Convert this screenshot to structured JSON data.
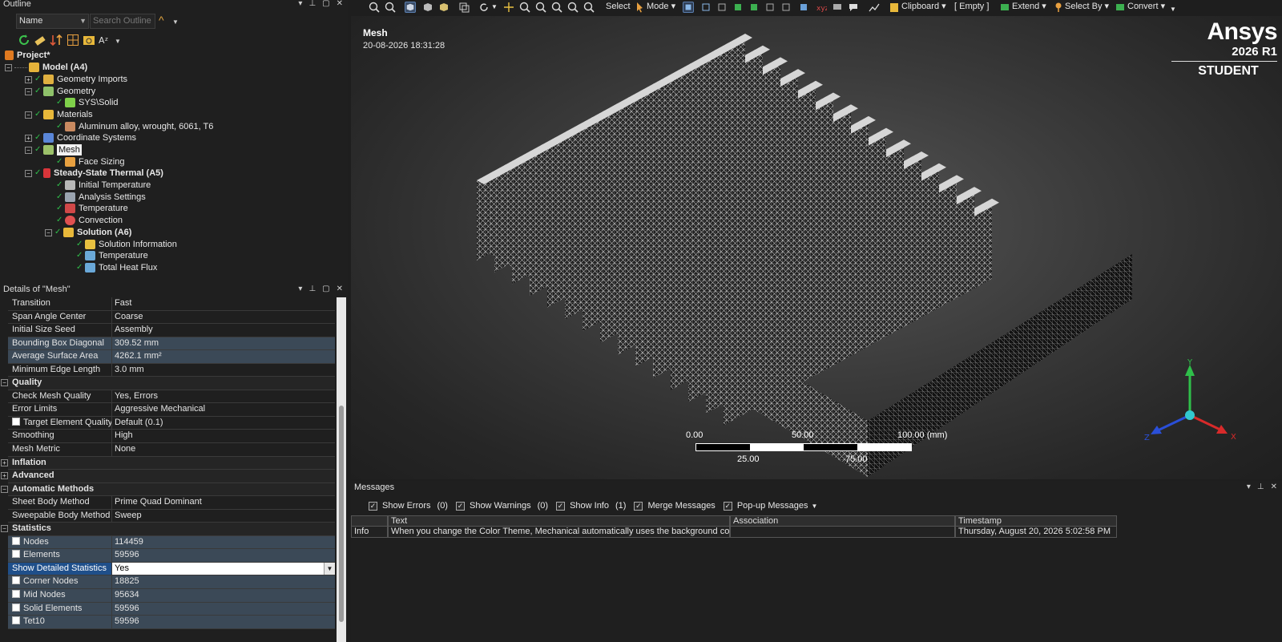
{
  "outline": {
    "title": "Outline",
    "name_select": "Name",
    "search_placeholder": "Search Outline",
    "tree": {
      "project": "Project*",
      "model": "Model (A4)",
      "geometry_imports": "Geometry Imports",
      "geometry": "Geometry",
      "sys_solid": "SYS\\Solid",
      "materials": "Materials",
      "aluminum": "Aluminum alloy, wrought, 6061, T6",
      "coord": "Coordinate Systems",
      "mesh": "Mesh",
      "face_sizing": "Face Sizing",
      "thermal": "Steady-State Thermal (A5)",
      "init_temp": "Initial Temperature",
      "analysis_settings": "Analysis Settings",
      "temperature": "Temperature",
      "convection": "Convection",
      "solution": "Solution (A6)",
      "sol_info": "Solution Information",
      "sol_temp": "Temperature",
      "heat_flux": "Total Heat Flux"
    }
  },
  "details": {
    "title": "Details of \"Mesh\"",
    "rows": {
      "transition": {
        "k": "Transition",
        "v": "Fast"
      },
      "span": {
        "k": "Span Angle Center",
        "v": "Coarse"
      },
      "seed": {
        "k": "Initial Size Seed",
        "v": "Assembly"
      },
      "bbox": {
        "k": "Bounding Box Diagonal",
        "v": "309.52 mm"
      },
      "avg_area": {
        "k": "Average Surface Area",
        "v": "4262.1 mm²"
      },
      "min_edge": {
        "k": "Minimum Edge Length",
        "v": "3.0 mm"
      },
      "quality": {
        "k": "Quality"
      },
      "check_quality": {
        "k": "Check Mesh Quality",
        "v": "Yes, Errors"
      },
      "error_limits": {
        "k": "Error Limits",
        "v": "Aggressive Mechanical"
      },
      "target_quality": {
        "k": "Target Element Quality",
        "v": "Default (0.1)"
      },
      "smoothing": {
        "k": "Smoothing",
        "v": "High"
      },
      "metric": {
        "k": "Mesh Metric",
        "v": "None"
      },
      "inflation": {
        "k": "Inflation"
      },
      "advanced": {
        "k": "Advanced"
      },
      "auto_methods": {
        "k": "Automatic Methods"
      },
      "sheet_method": {
        "k": "Sheet Body Method",
        "v": "Prime Quad Dominant"
      },
      "sweep_method": {
        "k": "Sweepable Body Method",
        "v": "Sweep"
      },
      "statistics": {
        "k": "Statistics"
      },
      "nodes": {
        "k": "Nodes",
        "v": "114459"
      },
      "elements": {
        "k": "Elements",
        "v": "59596"
      },
      "show_detailed": {
        "k": "Show Detailed Statistics",
        "v": "Yes"
      },
      "corner_nodes": {
        "k": "Corner Nodes",
        "v": "18825"
      },
      "mid_nodes": {
        "k": "Mid Nodes",
        "v": "95634"
      },
      "solid_elements": {
        "k": "Solid Elements",
        "v": "59596"
      },
      "tet10": {
        "k": "Tet10",
        "v": "59596"
      }
    }
  },
  "toolbar": {
    "select": "Select",
    "mode": "Mode",
    "clipboard": "Clipboard",
    "empty": "[ Empty ]",
    "extend": "Extend",
    "select_by": "Select By",
    "convert": "Convert"
  },
  "viewport": {
    "title": "Mesh",
    "timestamp": "20-08-2026 18:31:28",
    "logo_name": "Ansys",
    "logo_version": "2026 R1",
    "logo_edition": "STUDENT",
    "scale": {
      "t0": "0.00",
      "t50": "50.00",
      "t100": "100.00 (mm)",
      "t25": "25.00",
      "t75": "75.00"
    },
    "triad": {
      "x": "X",
      "y": "Y",
      "z": "Z"
    }
  },
  "messages": {
    "title": "Messages",
    "filters": {
      "errors": {
        "label": "Show Errors",
        "count": "(0)"
      },
      "warnings": {
        "label": "Show Warnings",
        "count": "(0)"
      },
      "info": {
        "label": "Show Info",
        "count": "(1)"
      },
      "merge": {
        "label": "Merge Messages"
      },
      "popup": {
        "label": "Pop-up Messages"
      }
    },
    "columns": {
      "text": "Text",
      "association": "Association",
      "timestamp": "Timestamp"
    },
    "rows": [
      {
        "type": "Info",
        "text": "When you change the Color Theme, Mechanical automatically uses the background color",
        "association": "",
        "timestamp": "Thursday, August 20, 2026 5:02:58 PM"
      }
    ]
  },
  "colors": {
    "accent": "#1f4f8a",
    "check": "#2fbf4a",
    "highlight_row": "#3b4957",
    "viewport_center": "#565656"
  }
}
